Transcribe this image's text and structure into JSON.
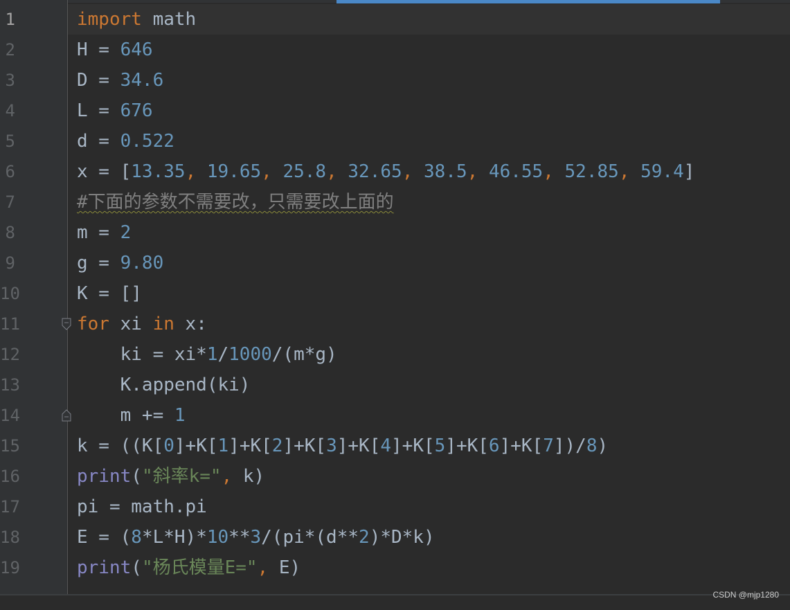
{
  "editor": {
    "current_line": 1,
    "lines": [
      {
        "n": "1",
        "tokens": [
          [
            "kw",
            "import"
          ],
          [
            "p",
            " math"
          ]
        ]
      },
      {
        "n": "2",
        "tokens": [
          [
            "p",
            "H = "
          ],
          [
            "num",
            "646"
          ]
        ]
      },
      {
        "n": "3",
        "tokens": [
          [
            "p",
            "D = "
          ],
          [
            "num",
            "34.6"
          ]
        ]
      },
      {
        "n": "4",
        "tokens": [
          [
            "p",
            "L = "
          ],
          [
            "num",
            "676"
          ]
        ]
      },
      {
        "n": "5",
        "tokens": [
          [
            "p",
            "d = "
          ],
          [
            "num",
            "0.522"
          ]
        ]
      },
      {
        "n": "6",
        "tokens": [
          [
            "p",
            "x = ["
          ],
          [
            "num",
            "13.35"
          ],
          [
            "kw",
            ", "
          ],
          [
            "num",
            "19.65"
          ],
          [
            "kw",
            ", "
          ],
          [
            "num",
            "25.8"
          ],
          [
            "kw",
            ", "
          ],
          [
            "num",
            "32.65"
          ],
          [
            "kw",
            ", "
          ],
          [
            "num",
            "38.5"
          ],
          [
            "kw",
            ", "
          ],
          [
            "num",
            "46.55"
          ],
          [
            "kw",
            ", "
          ],
          [
            "num",
            "52.85"
          ],
          [
            "kw",
            ", "
          ],
          [
            "num",
            "59.4"
          ],
          [
            "p",
            "]"
          ]
        ]
      },
      {
        "n": "7",
        "tokens": [
          [
            "comment",
            "#下面的参数不需要改，只需要改上面的"
          ]
        ]
      },
      {
        "n": "8",
        "tokens": [
          [
            "p",
            "m = "
          ],
          [
            "num",
            "2"
          ]
        ]
      },
      {
        "n": "9",
        "tokens": [
          [
            "p",
            "g = "
          ],
          [
            "num",
            "9.80"
          ]
        ]
      },
      {
        "n": "10",
        "tokens": [
          [
            "p",
            "K = []"
          ]
        ]
      },
      {
        "n": "11",
        "tokens": [
          [
            "kw",
            "for"
          ],
          [
            "p",
            " xi "
          ],
          [
            "kw",
            "in"
          ],
          [
            "p",
            " x:"
          ]
        ]
      },
      {
        "n": "12",
        "tokens": [
          [
            "p",
            "    ki = xi*"
          ],
          [
            "num",
            "1"
          ],
          [
            "p",
            "/"
          ],
          [
            "num",
            "1000"
          ],
          [
            "p",
            "/(m*g)"
          ]
        ]
      },
      {
        "n": "13",
        "tokens": [
          [
            "p",
            "    K.append(ki)"
          ]
        ]
      },
      {
        "n": "14",
        "tokens": [
          [
            "p",
            "    m += "
          ],
          [
            "num",
            "1"
          ]
        ]
      },
      {
        "n": "15",
        "tokens": [
          [
            "p",
            "k = ((K["
          ],
          [
            "num",
            "0"
          ],
          [
            "p",
            "]+K["
          ],
          [
            "num",
            "1"
          ],
          [
            "p",
            "]+K["
          ],
          [
            "num",
            "2"
          ],
          [
            "p",
            "]+K["
          ],
          [
            "num",
            "3"
          ],
          [
            "p",
            "]+K["
          ],
          [
            "num",
            "4"
          ],
          [
            "p",
            "]+K["
          ],
          [
            "num",
            "5"
          ],
          [
            "p",
            "]+K["
          ],
          [
            "num",
            "6"
          ],
          [
            "p",
            "]+K["
          ],
          [
            "num",
            "7"
          ],
          [
            "p",
            "])/"
          ],
          [
            "num",
            "8"
          ],
          [
            "p",
            ")"
          ]
        ]
      },
      {
        "n": "16",
        "tokens": [
          [
            "builtin",
            "print"
          ],
          [
            "p",
            "("
          ],
          [
            "str",
            "\"斜率k=\""
          ],
          [
            "kw",
            ", "
          ],
          [
            "p",
            "k)"
          ]
        ]
      },
      {
        "n": "17",
        "tokens": [
          [
            "p",
            "pi = math.pi"
          ]
        ]
      },
      {
        "n": "18",
        "tokens": [
          [
            "p",
            "E = ("
          ],
          [
            "num",
            "8"
          ],
          [
            "p",
            "*L*H)*"
          ],
          [
            "num",
            "10"
          ],
          [
            "p",
            "**"
          ],
          [
            "num",
            "3"
          ],
          [
            "p",
            "/(pi*(d**"
          ],
          [
            "num",
            "2"
          ],
          [
            "p",
            ")*D*k)"
          ]
        ]
      },
      {
        "n": "19",
        "tokens": [
          [
            "builtin",
            "print"
          ],
          [
            "p",
            "("
          ],
          [
            "str",
            "\"杨氏模量E=\""
          ],
          [
            "kw",
            ", "
          ],
          [
            "p",
            "E)"
          ]
        ]
      }
    ],
    "fold_markers": [
      {
        "line": 11,
        "kind": "open-fold-icon"
      },
      {
        "line": 14,
        "kind": "close-fold-icon"
      }
    ]
  },
  "watermark": "CSDN @mjp1280",
  "colors": {
    "background": "#2b2b2b",
    "gutter": "#313335",
    "keyword": "#cc7832",
    "number": "#6897bb",
    "string": "#6a8759",
    "builtin": "#8888c6",
    "comment": "#808080",
    "text": "#a9b7c6",
    "scrollbar": "#4a88c7"
  }
}
